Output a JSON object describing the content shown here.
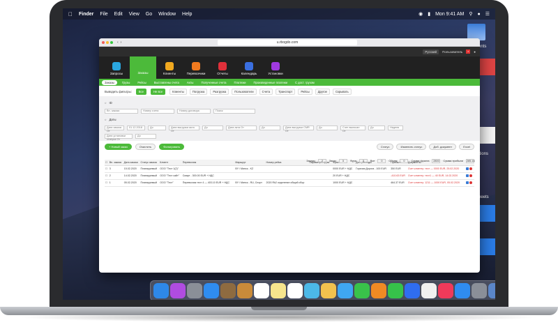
{
  "menubar": {
    "app_name": "Finder",
    "menus": [
      "File",
      "Edit",
      "View",
      "Go",
      "Window",
      "Help"
    ],
    "clock": "Mon 9:41 AM"
  },
  "desktop_labels": [
    "ents",
    "ations",
    "heets"
  ],
  "browser": {
    "url": "u.rbogdo.com",
    "lang": "Русский",
    "user": "Пользователь"
  },
  "nav": {
    "items": [
      {
        "label": "Запросы",
        "color": "#2aa7e0"
      },
      {
        "label": "Заказы",
        "color": "#4cba3a"
      },
      {
        "label": "Клиенты",
        "color": "#f0a81f"
      },
      {
        "label": "Перевозчики",
        "color": "#f07a1f"
      },
      {
        "label": "Отчеты",
        "color": "#e0303a"
      },
      {
        "label": "Календарь",
        "color": "#3a6fe0"
      },
      {
        "label": "Установки",
        "color": "#a03ae0"
      }
    ],
    "active_index": 1
  },
  "subnav": [
    "Заказы",
    "Грузы",
    "Рейсы",
    "Выставлены счета",
    "Акты",
    "Полученные счета",
    "Платежи",
    "Произведенные платежи",
    "С дост. грузом"
  ],
  "filters": {
    "show_label": "Выводить фильтры:",
    "toggle_all": "Все",
    "toggle_none": "Не все",
    "chips": [
      "Клиенты",
      "Погрузка",
      "Разгрузка",
      "Пользователи",
      "Счета",
      "Транспорт",
      "Рейсы",
      "Другое",
      "Скрывать"
    ],
    "id_label": "ID",
    "id_fields": [
      "Вн. заказа",
      "Номер счета",
      "Номер договора",
      "Поиск"
    ],
    "search_placeholder": "Поиск",
    "dates_label": "Даты",
    "date_fields": [
      "Дата заказа От",
      "Дата выгрузки акта От",
      "Дата акта От",
      "Дата выгрузки CMR От",
      "Счет выписан От",
      "Неделя",
      "Дата установки статуса От"
    ],
    "date_value": "01.12.2018",
    "to_label": "До"
  },
  "actions": {
    "new_order": "+ Новый заказ",
    "clear": "Очистить",
    "apply": "Фильтровать"
  },
  "pager": {
    "labels": [
      "Заказы",
      "Заказ",
      "Фура",
      "Все",
      "Объем",
      "Сумма фрахта",
      "Сумма прибыли"
    ],
    "values": [
      "2",
      "3",
      "3",
      "0",
      "0",
      "2800",
      "285.16"
    ],
    "status_select": "Статус",
    "change_status": "Изменить статус",
    "add_invoice": "Доб. документ",
    "export": "Excel"
  },
  "table": {
    "headers": [
      "Вн. заказа",
      "Дата заказа",
      "Статус заказа",
      "Клиент",
      "Перевозчик",
      "Маршрут",
      "Номер рейса",
      "Параметры груза",
      "Фрахт",
      "Доп. расходы",
      "Прибыль",
      "Документы"
    ],
    "rows": [
      {
        "id": "3",
        "date": "15.02.2020",
        "status": "Планируемый",
        "client": "ООО \"Тест 1(2)\"",
        "carrier": "",
        "route": "BY / Минск - KZ",
        "trip": "",
        "cargo": "",
        "freight": "0000 EUR + НДС",
        "extra": "Горячая Дорога - 100 EUR",
        "profit": "350 EUR",
        "docs": "Счет клиенту: тест — 0000 EUR, 25.02.2020"
      },
      {
        "id": "2",
        "date": "14.02.2020",
        "status": "Планируемый",
        "client": "ООО \"Тест сайт\"",
        "carrier": "Смарт - 300.00 EUR + НДС",
        "route": "",
        "trip": "",
        "cargo": "",
        "freight": "20 EUR + НДС",
        "extra": "",
        "profit": "-410.63 EUR",
        "docs": "Счет клиенту: тест1 — 40 EUR, 14.02.2020"
      },
      {
        "id": "1",
        "date": "05.02.2020",
        "status": "Планируемый",
        "client": "ООО \"Тест\"",
        "carrier": "Перевозчик тест 4 — 403.10 EUR + НДС",
        "route": "BY / Минск - RU, Спорт",
        "trip": "2020 Rk2 отделение общий сбор",
        "cargo": "",
        "freight": "1000 EUR + НДС",
        "extra": "",
        "profit": "464.37 EUR",
        "docs": "Счет клиенту: 1211 — 1000 EUR, 05.02.2020"
      }
    ]
  },
  "dock": {
    "apps": [
      "finder-icon",
      "siri-icon",
      "launchpad-icon",
      "safari-icon",
      "photos-preview-icon",
      "notes-book-icon",
      "calendar-icon",
      "notes-icon",
      "reminders-icon",
      "maps-icon",
      "photos-icon",
      "messages-icon",
      "facetime-icon",
      "pages-icon",
      "numbers-icon",
      "keynote-icon",
      "news-icon",
      "music-icon",
      "appstore-icon",
      "settings-icon",
      "downloads-icon",
      "trash-icon"
    ]
  }
}
